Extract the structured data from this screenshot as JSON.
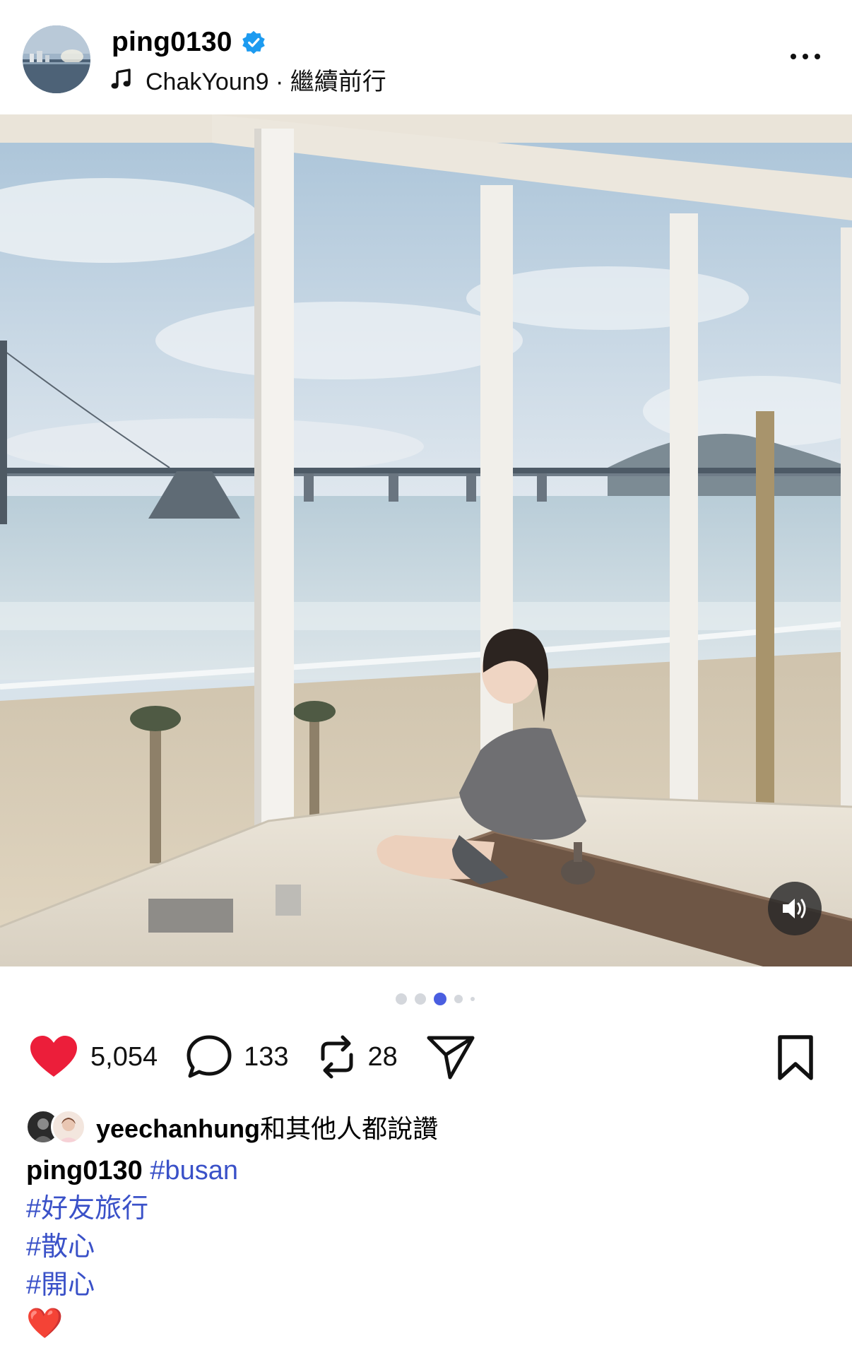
{
  "post": {
    "username": "ping0130",
    "verified": true,
    "music": {
      "artist": "ChakYoun9",
      "separator": " · ",
      "song": "繼續前行"
    }
  },
  "media": {
    "carousel": {
      "total": 5,
      "active_index": 2
    },
    "sound_button": "speaker-icon"
  },
  "actions": {
    "likes": "5,054",
    "comments": "133",
    "reposts": "28",
    "liked": true
  },
  "likes_line": {
    "user": "yeechanhung",
    "suffix": "和其他人都說讚"
  },
  "caption": {
    "user": "ping0130",
    "first_tag": "#busan",
    "lines": [
      "#好友旅行",
      "#散心",
      "#開心"
    ],
    "emoji": "❤️"
  },
  "colors": {
    "like": "#ec1e3a",
    "hashtag": "#3a51c8",
    "verified": "#1d9bf0",
    "dot_active": "#4a5ee0",
    "dot_inactive": "#d4d7dc"
  }
}
